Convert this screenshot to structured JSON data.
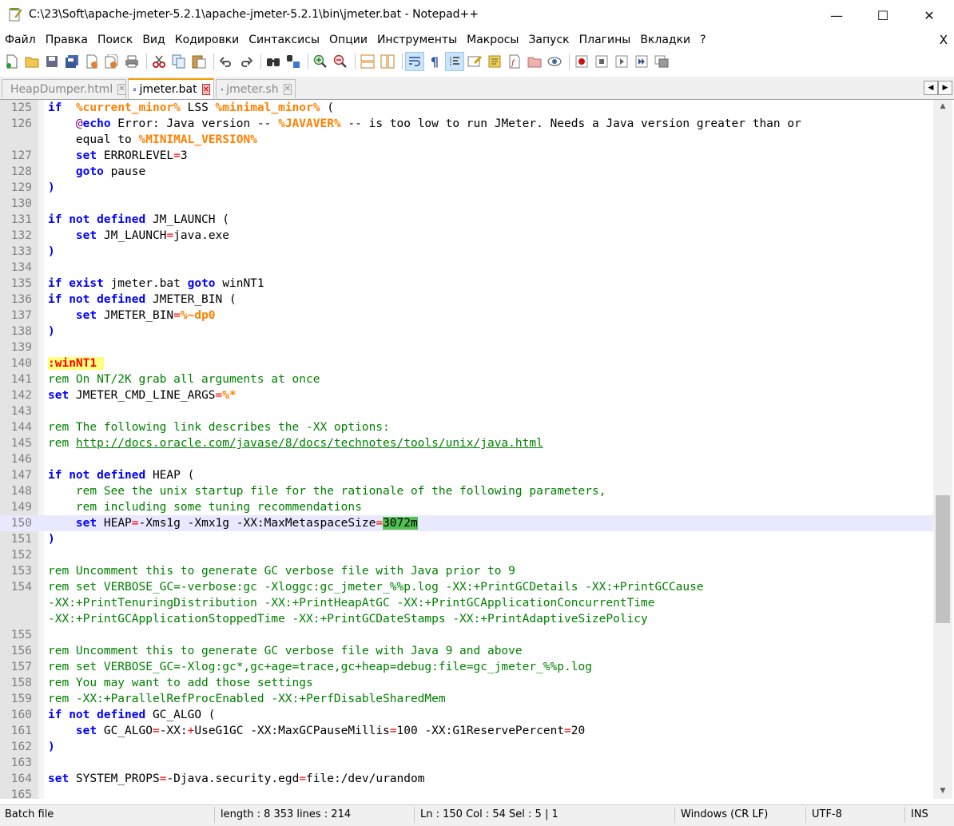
{
  "window": {
    "title": "C:\\23\\Soft\\apache-jmeter-5.2.1\\apache-jmeter-5.2.1\\bin\\jmeter.bat - Notepad++",
    "minimize": "—",
    "maximize": "☐",
    "close": "✕"
  },
  "menu": [
    "Файл",
    "Правка",
    "Поиск",
    "Вид",
    "Кодировки",
    "Синтаксисы",
    "Опции",
    "Инструменты",
    "Макросы",
    "Запуск",
    "Плагины",
    "Вкладки",
    "?"
  ],
  "menu_close": "X",
  "toolbar": [
    "new-file-icon",
    "open-file-icon",
    "save-icon",
    "save-all-icon",
    "close-icon",
    "close-all-icon",
    "print-icon",
    "cut-icon",
    "copy-icon",
    "paste-icon",
    "undo-icon",
    "redo-icon",
    "find-icon",
    "replace-icon",
    "zoom-in-icon",
    "zoom-out-icon",
    "sync-v-icon",
    "sync-h-icon",
    "word-wrap-icon",
    "show-all-chars-icon",
    "indent-guide-icon",
    "udl-icon",
    "doc-map-icon",
    "function-list-icon",
    "folder-workspace-icon",
    "monitor-icon",
    "record-macro-icon",
    "stop-macro-icon",
    "play-macro-icon",
    "run-macro-multiple-icon",
    "save-macro-icon"
  ],
  "tabs": [
    {
      "label": "HeapDumper.html",
      "close": "✕"
    },
    {
      "label": "jmeter.bat",
      "close": "✕"
    },
    {
      "label": "jmeter.sh",
      "close": "✕"
    }
  ],
  "tabnav": {
    "left": "◀",
    "right": "▶"
  },
  "scroll": {
    "up": "▲",
    "down": "▼"
  },
  "lines": [
    {
      "n": "125",
      "t": [
        [
          "kw",
          "if"
        ],
        [
          "",
          "  "
        ],
        [
          "var",
          "%current_minor%"
        ],
        [
          "",
          " LSS "
        ],
        [
          "var",
          "%minimal_minor%"
        ],
        [
          "",
          " ("
        ]
      ]
    },
    {
      "n": "126",
      "t": [
        [
          "",
          "    "
        ],
        [
          "at",
          "@"
        ],
        [
          "kw",
          "echo"
        ],
        [
          "",
          " Error: Java version -- "
        ],
        [
          "var",
          "%JAVAVER%"
        ],
        [
          "",
          " -- is too low to run JMeter. Needs a Java version greater than or"
        ]
      ]
    },
    {
      "n": "",
      "t": [
        [
          "",
          "    equal to "
        ],
        [
          "var",
          "%MINIMAL_VERSION%"
        ]
      ]
    },
    {
      "n": "127",
      "t": [
        [
          "",
          "    "
        ],
        [
          "kw",
          "set"
        ],
        [
          "",
          " ERRORLEVEL"
        ],
        [
          "op",
          "="
        ],
        [
          "",
          "3"
        ]
      ]
    },
    {
      "n": "128",
      "t": [
        [
          "",
          "    "
        ],
        [
          "kw",
          "goto"
        ],
        [
          "",
          " pause"
        ]
      ]
    },
    {
      "n": "129",
      "t": [
        [
          "kw",
          ")"
        ]
      ]
    },
    {
      "n": "130",
      "t": []
    },
    {
      "n": "131",
      "t": [
        [
          "kw",
          "if not defined"
        ],
        [
          "",
          " JM_LAUNCH ("
        ]
      ]
    },
    {
      "n": "132",
      "t": [
        [
          "",
          "    "
        ],
        [
          "kw",
          "set"
        ],
        [
          "",
          " JM_LAUNCH"
        ],
        [
          "op",
          "="
        ],
        [
          "",
          "java.exe"
        ]
      ]
    },
    {
      "n": "133",
      "t": [
        [
          "kw",
          ")"
        ]
      ]
    },
    {
      "n": "134",
      "t": []
    },
    {
      "n": "135",
      "t": [
        [
          "kw",
          "if exist"
        ],
        [
          "",
          " jmeter.bat "
        ],
        [
          "kw",
          "goto"
        ],
        [
          "",
          " winNT1"
        ]
      ]
    },
    {
      "n": "136",
      "t": [
        [
          "kw",
          "if not defined"
        ],
        [
          "",
          " JMETER_BIN ("
        ]
      ]
    },
    {
      "n": "137",
      "t": [
        [
          "",
          "    "
        ],
        [
          "kw",
          "set"
        ],
        [
          "",
          " JMETER_BIN"
        ],
        [
          "op",
          "="
        ],
        [
          "var",
          "%~dp0"
        ]
      ]
    },
    {
      "n": "138",
      "t": [
        [
          "kw",
          ")"
        ]
      ]
    },
    {
      "n": "139",
      "t": []
    },
    {
      "n": "140",
      "t": [
        [
          "lbl",
          ":winNT1 "
        ]
      ]
    },
    {
      "n": "141",
      "t": [
        [
          "cm",
          "rem On NT/2K grab all arguments at once"
        ]
      ]
    },
    {
      "n": "142",
      "t": [
        [
          "kw",
          "set"
        ],
        [
          "",
          " JMETER_CMD_LINE_ARGS"
        ],
        [
          "op",
          "="
        ],
        [
          "var",
          "%*"
        ]
      ]
    },
    {
      "n": "143",
      "t": []
    },
    {
      "n": "144",
      "t": [
        [
          "cm",
          "rem The following link describes the -XX options:"
        ]
      ]
    },
    {
      "n": "145",
      "t": [
        [
          "cm",
          "rem "
        ],
        [
          "cm link",
          "http://docs.oracle.com/javase/8/docs/technotes/tools/unix/java.html"
        ]
      ]
    },
    {
      "n": "146",
      "t": []
    },
    {
      "n": "147",
      "t": [
        [
          "kw",
          "if not defined"
        ],
        [
          "",
          " HEAP ("
        ]
      ]
    },
    {
      "n": "148",
      "t": [
        [
          "cm",
          "    rem See the unix startup file for the rationale of the following parameters,"
        ]
      ]
    },
    {
      "n": "149",
      "t": [
        [
          "cm",
          "    rem including some tuning recommendations"
        ]
      ]
    },
    {
      "n": "150",
      "cur": true,
      "t": [
        [
          "",
          "    "
        ],
        [
          "kw",
          "set"
        ],
        [
          "",
          " HEAP"
        ],
        [
          "op",
          "="
        ],
        [
          "",
          "-Xms1g -Xmx1g -XX:MaxMetaspaceSize"
        ],
        [
          "op",
          "="
        ],
        [
          "hl",
          "3072m"
        ]
      ]
    },
    {
      "n": "151",
      "t": [
        [
          "kw",
          ")"
        ]
      ]
    },
    {
      "n": "152",
      "t": []
    },
    {
      "n": "153",
      "t": [
        [
          "cm",
          "rem Uncomment this to generate GC verbose file with Java prior to 9"
        ]
      ]
    },
    {
      "n": "154",
      "t": [
        [
          "cm",
          "rem set VERBOSE_GC=-verbose:gc -Xloggc:gc_jmeter_%%p.log -XX:+PrintGCDetails -XX:+PrintGCCause"
        ]
      ]
    },
    {
      "n": "",
      "t": [
        [
          "cm",
          "-XX:+PrintTenuringDistribution -XX:+PrintHeapAtGC -XX:+PrintGCApplicationConcurrentTime"
        ]
      ]
    },
    {
      "n": "",
      "t": [
        [
          "cm",
          "-XX:+PrintGCApplicationStoppedTime -XX:+PrintGCDateStamps -XX:+PrintAdaptiveSizePolicy"
        ]
      ]
    },
    {
      "n": "155",
      "t": []
    },
    {
      "n": "156",
      "t": [
        [
          "cm",
          "rem Uncomment this to generate GC verbose file with Java 9 and above"
        ]
      ]
    },
    {
      "n": "157",
      "t": [
        [
          "cm",
          "rem set VERBOSE_GC=-Xlog:gc*,gc+age=trace,gc+heap=debug:file=gc_jmeter_%%p.log"
        ]
      ]
    },
    {
      "n": "158",
      "t": [
        [
          "cm",
          "rem You may want to add those settings"
        ]
      ]
    },
    {
      "n": "159",
      "t": [
        [
          "cm",
          "rem -XX:+ParallelRefProcEnabled -XX:+PerfDisableSharedMem"
        ]
      ]
    },
    {
      "n": "160",
      "t": [
        [
          "kw",
          "if not defined"
        ],
        [
          "",
          " GC_ALGO ("
        ]
      ]
    },
    {
      "n": "161",
      "t": [
        [
          "",
          "    "
        ],
        [
          "kw",
          "set"
        ],
        [
          "",
          " GC_ALGO"
        ],
        [
          "op",
          "="
        ],
        [
          "",
          "-XX:"
        ],
        [
          "op",
          "+"
        ],
        [
          "",
          "UseG1GC -XX:MaxGCPauseMillis"
        ],
        [
          "op",
          "="
        ],
        [
          "",
          "100 -XX:G1ReservePercent"
        ],
        [
          "op",
          "="
        ],
        [
          "",
          "20"
        ]
      ]
    },
    {
      "n": "162",
      "t": [
        [
          "kw",
          ")"
        ]
      ]
    },
    {
      "n": "163",
      "t": []
    },
    {
      "n": "164",
      "t": [
        [
          "kw",
          "set"
        ],
        [
          "",
          " SYSTEM_PROPS"
        ],
        [
          "op",
          "="
        ],
        [
          "",
          "-Djava.security.egd"
        ],
        [
          "op",
          "="
        ],
        [
          "",
          "file:/dev/urandom"
        ]
      ]
    },
    {
      "n": "165",
      "t": []
    }
  ],
  "status": {
    "type": "Batch file",
    "length": "length : 8 353    lines : 214",
    "position": "Ln : 150    Col : 54    Sel : 5 | 1",
    "eol": "Windows (CR LF)",
    "encoding": "UTF-8",
    "mode": "INS"
  },
  "colors": {
    "keyword": "#0000ff",
    "variable": "#ff8000",
    "comment": "#008000",
    "operator": "#ff0000",
    "current_line": "#e8e8ff",
    "selection_match": "#50c050"
  }
}
